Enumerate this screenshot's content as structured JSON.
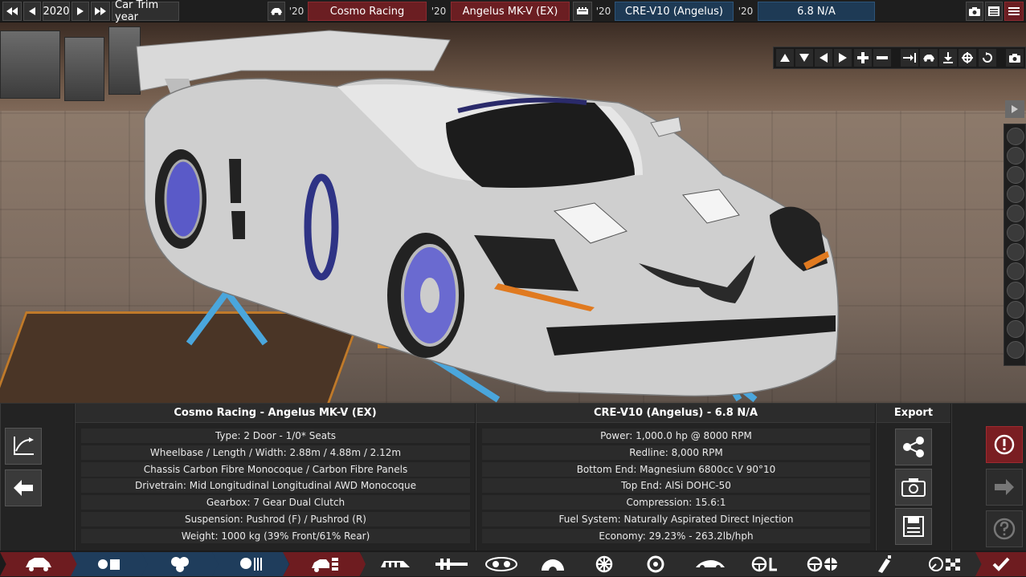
{
  "topbar": {
    "trim_year": "2020",
    "trim_label": "Car Trim year",
    "model_year_short": "'20",
    "company": "Cosmo Racing",
    "family_year_short": "'20",
    "model": "Angelus MK-V (EX)",
    "engine_year_short": "'20",
    "engine_family": "CRE-V10 (Angelus)",
    "variant_year_short": "'20",
    "engine_variant": "6.8 N/A"
  },
  "car_panel": {
    "title": "Cosmo Racing - Angelus MK-V (EX)",
    "rows": [
      "Type: 2 Door - 1/0* Seats",
      "Wheelbase / Length / Width: 2.88m / 4.88m / 2.12m",
      "Chassis Carbon Fibre Monocoque / Carbon Fibre Panels",
      "Drivetrain: Mid Longitudinal Longitudinal AWD Monocoque",
      "Gearbox: 7 Gear Dual Clutch",
      "Suspension: Pushrod (F) / Pushrod (R)",
      "Weight: 1000 kg (39% Front/61% Rear)"
    ]
  },
  "engine_panel": {
    "title": "CRE-V10 (Angelus) - 6.8 N/A",
    "rows": [
      "Power: 1,000.0 hp @ 8000 RPM",
      "Redline:  8,000 RPM",
      "Bottom End: Magnesium 6800cc V 90°10",
      "Top End: AlSi DOHC-50",
      "Compression: 15.6:1",
      "Fuel System: Naturally Aspirated Direct Injection",
      "Economy: 29.23% - 263.2lb/hph"
    ]
  },
  "export_panel": {
    "title": "Export"
  },
  "colors": {
    "accent_red": "#6e1c20",
    "accent_blue": "#1f3d5c",
    "panel_bg": "#232323"
  },
  "icons": [
    "rewind-icon",
    "back-icon",
    "forward-icon",
    "fast-forward-icon",
    "car-icon",
    "engine-icon",
    "camera-icon",
    "menu-icon",
    "chart-icon",
    "arrow-left-icon",
    "share-icon",
    "save-icon",
    "warning-icon",
    "arrow-right-icon",
    "help-icon",
    "checkmark-icon"
  ]
}
